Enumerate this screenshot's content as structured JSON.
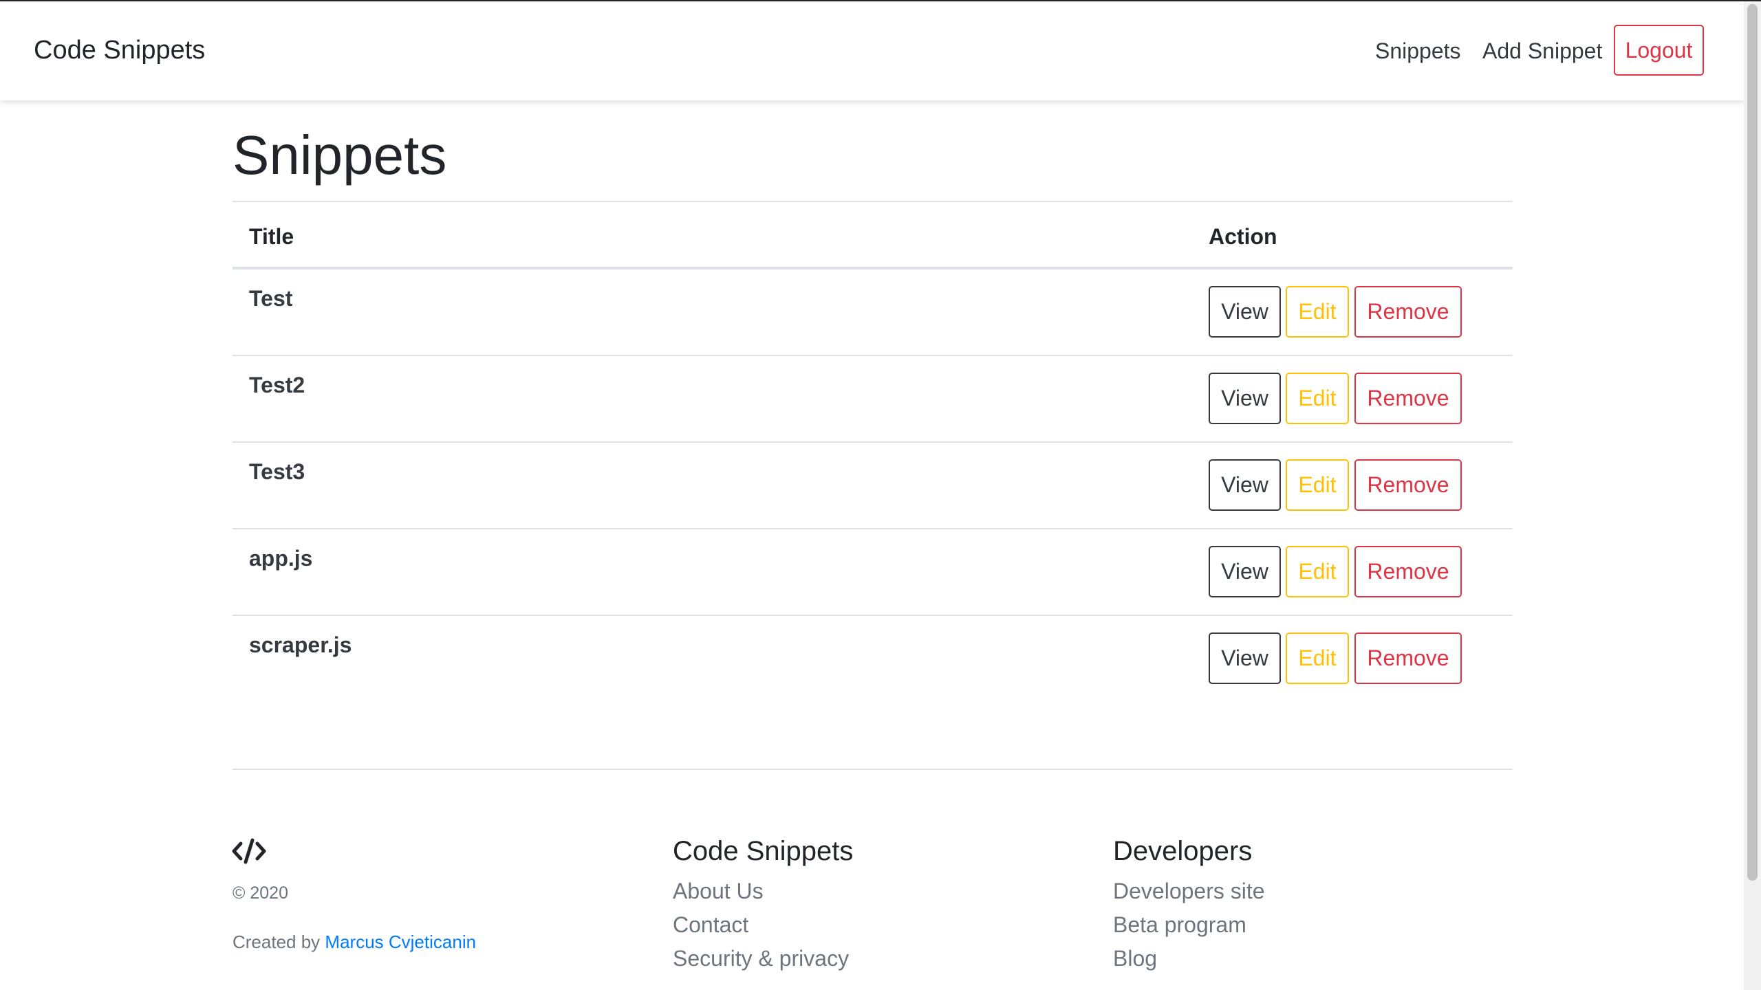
{
  "navbar": {
    "brand": "Code Snippets",
    "links": [
      "Snippets",
      "Add Snippet"
    ],
    "logout_label": "Logout",
    "colors": {
      "logout": "#dc3545"
    }
  },
  "main": {
    "title": "Snippets",
    "table": {
      "headers": {
        "title": "Title",
        "action": "Action"
      },
      "rows": [
        {
          "title": "Test"
        },
        {
          "title": "Test2"
        },
        {
          "title": "Test3"
        },
        {
          "title": "app.js"
        },
        {
          "title": "scraper.js"
        }
      ],
      "actions": {
        "view": "View",
        "edit": "Edit",
        "remove": "Remove"
      },
      "colors": {
        "view": "#343a40",
        "edit": "#ffc107",
        "remove": "#dc3545"
      }
    }
  },
  "footer": {
    "logo_icon": "code-icon",
    "copyright": "© 2020",
    "created_by_prefix": "Created by",
    "author": "Marcus Cvjeticanin",
    "author_color": "#007bff",
    "columns": [
      {
        "heading": "Code Snippets",
        "links": [
          "About Us",
          "Contact",
          "Security & privacy"
        ]
      },
      {
        "heading": "Developers",
        "links": [
          "Developers site",
          "Beta program",
          "Blog"
        ]
      }
    ]
  }
}
